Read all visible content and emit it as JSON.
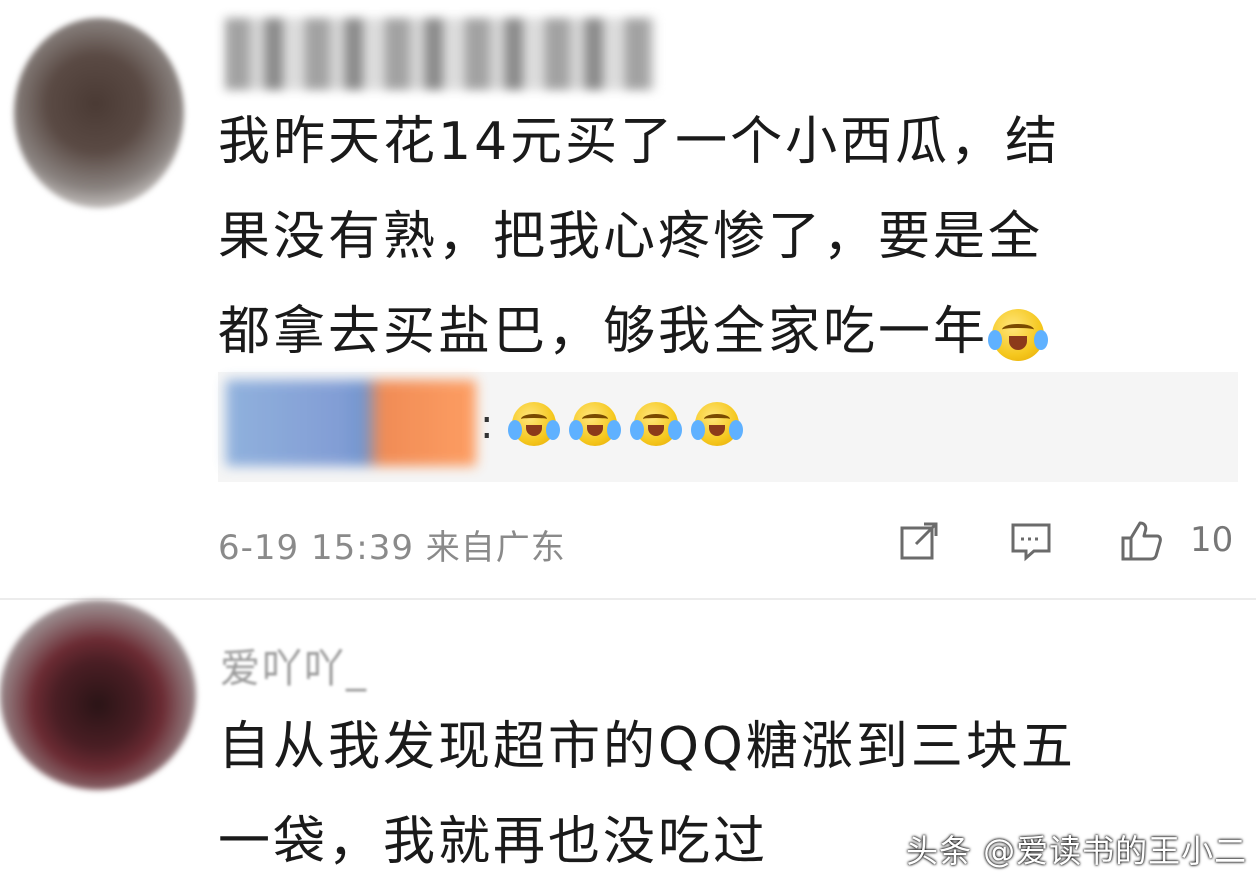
{
  "comments": [
    {
      "text_lines": [
        "我昨天花14元买了一个小西瓜，结",
        "果没有熟，把我心疼惨了，要是全",
        "都拿去买盐巴，够我全家吃一年"
      ],
      "emoji_inline": "laughing-crying-emoji",
      "reply": {
        "colon": ":",
        "emoji_count": 4,
        "emoji": "laughing-crying-emoji"
      },
      "meta": "6-19 15:39 来自广东",
      "actions": {
        "share": "share-icon",
        "comment": "comment-icon",
        "like": "thumbs-up-icon",
        "like_count": "10"
      }
    },
    {
      "author": "爱吖吖_",
      "text_lines": [
        "自从我发现超市的QQ糖涨到三块五",
        "一袋，我就再也没吃过"
      ]
    }
  ],
  "watermark": "头条 @爱读书的王小二"
}
